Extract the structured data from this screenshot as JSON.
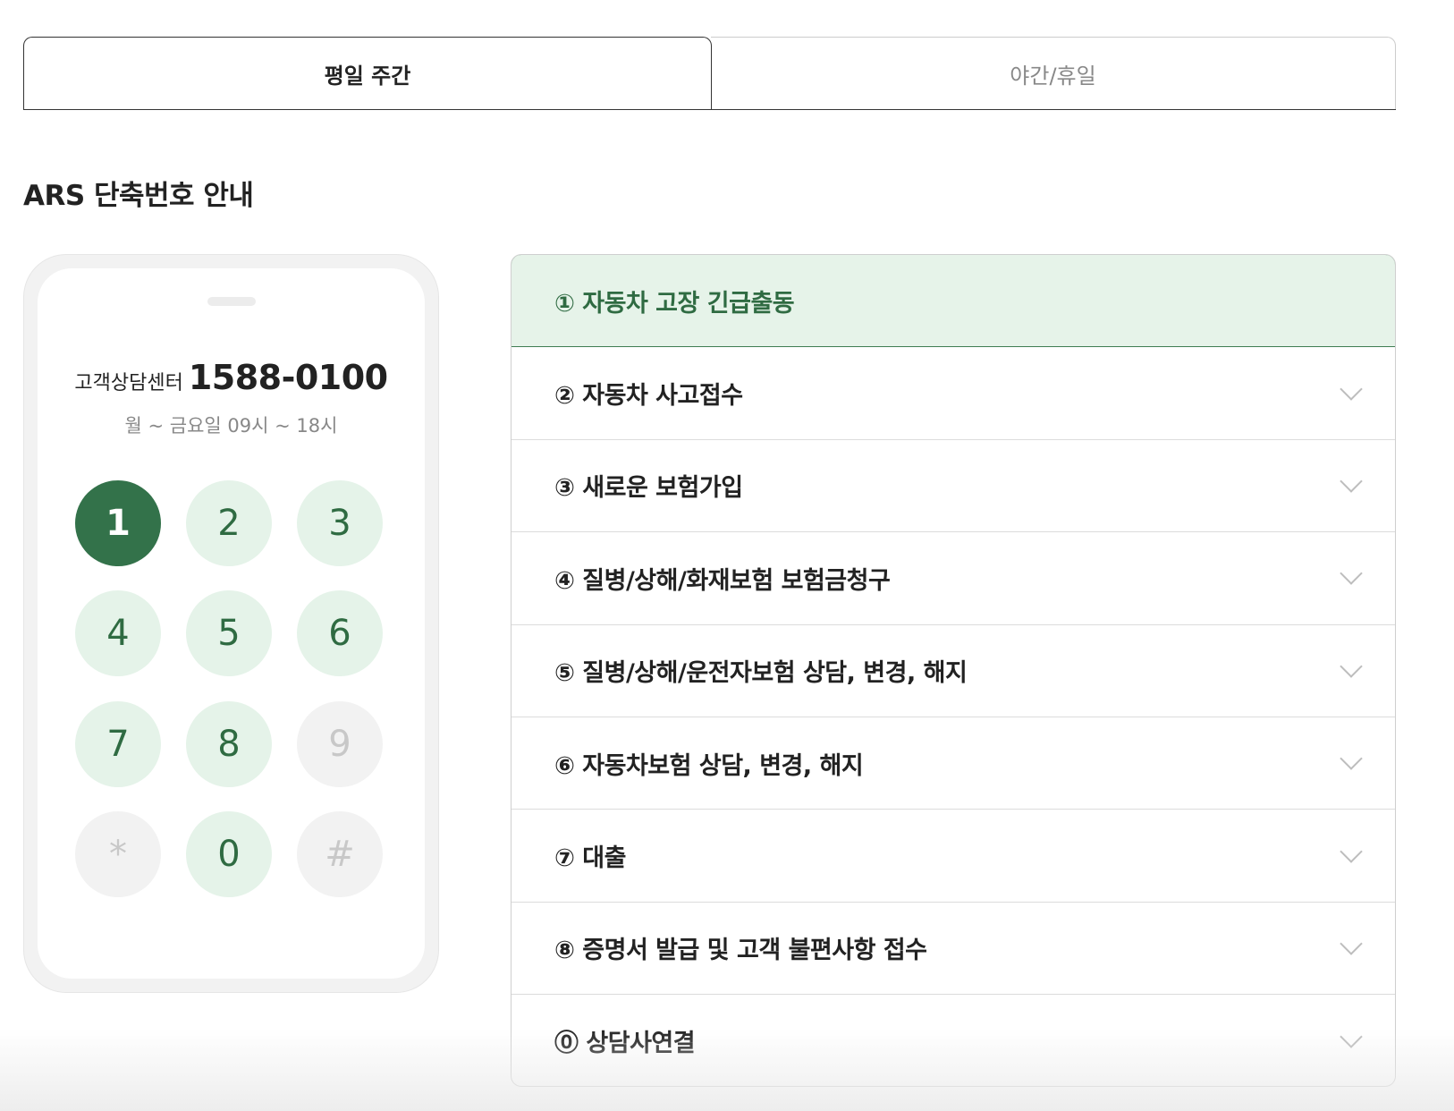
{
  "tabs": [
    {
      "label": "평일 주간",
      "active": true
    },
    {
      "label": "야간/휴일",
      "active": false
    }
  ],
  "section_title": "ARS 단축번호 안내",
  "phone": {
    "center_label": "고객상담센터",
    "center_number": "1588-0100",
    "hours": "월 ~ 금요일 09시 ~ 18시",
    "keys": [
      {
        "label": "1",
        "state": "selected"
      },
      {
        "label": "2",
        "state": "on"
      },
      {
        "label": "3",
        "state": "on"
      },
      {
        "label": "4",
        "state": "on"
      },
      {
        "label": "5",
        "state": "on"
      },
      {
        "label": "6",
        "state": "on"
      },
      {
        "label": "7",
        "state": "on"
      },
      {
        "label": "8",
        "state": "on"
      },
      {
        "label": "9",
        "state": "off"
      },
      {
        "label": "*",
        "state": "off"
      },
      {
        "label": "0",
        "state": "on"
      },
      {
        "label": "#",
        "state": "off"
      }
    ]
  },
  "menu": [
    {
      "label": "① 자동차 고장 긴급출동",
      "open": true
    },
    {
      "label": "② 자동차 사고접수",
      "open": false
    },
    {
      "label": "③ 새로운 보험가입",
      "open": false
    },
    {
      "label": "④ 질병/상해/화재보험 보험금청구",
      "open": false
    },
    {
      "label": "⑤ 질병/상해/운전자보험 상담, 변경, 해지",
      "open": false
    },
    {
      "label": "⑥ 자동차보험 상담, 변경, 해지",
      "open": false
    },
    {
      "label": "⑦ 대출",
      "open": false
    },
    {
      "label": "⑧ 증명서 발급 및 고객 불편사항 접수",
      "open": false
    },
    {
      "label": "⓪ 상담사연결",
      "open": false
    }
  ],
  "colors": {
    "accent": "#33724a",
    "accent_light": "#e5f3e9",
    "text": "#222222",
    "muted": "#888888"
  },
  "icons": {
    "accordion_toggle": "chevron-down-icon"
  }
}
